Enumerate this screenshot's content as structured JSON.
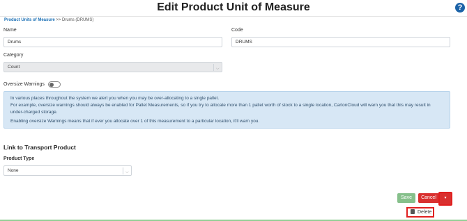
{
  "header": {
    "title": "Edit Product Unit of Measure",
    "help_icon": "?"
  },
  "breadcrumb": {
    "parent": "Product Units of Measure",
    "separator": ">>",
    "current": "Drums (DRUMS)"
  },
  "form": {
    "name_label": "Name",
    "name_value": "Drums",
    "code_label": "Code",
    "code_value": "DRUMS",
    "category_label": "Category",
    "category_value": "Count",
    "oversize_label": "Oversize Warnings",
    "oversize_enabled": false
  },
  "info": {
    "line1": "In various places throughout the system we alert you when you may be over-allocating to a single pallet.",
    "line2": "For example, oversize warnings should always be enabled for Pallet Measurements, so if you try to allocate more than 1 pallet worth of stock to a single location, CartonCloud will warn you that this may result in under-charged storage.",
    "line3": "Enabling oversize Warnings means that if ever you allocate over 1 of this measurement to a particular location, it'll warn you."
  },
  "transport": {
    "section_title": "Link to Transport Product",
    "product_type_label": "Product Type",
    "product_type_value": "None"
  },
  "actions": {
    "save_label": "Save",
    "cancel_label": "Cancel",
    "dropdown_caret": "▾",
    "delete_label": "Delete"
  },
  "colors": {
    "accent": "#1a6fb5",
    "danger": "#d9302f",
    "save": "#86c08b",
    "info_bg": "#d7e7f5"
  }
}
